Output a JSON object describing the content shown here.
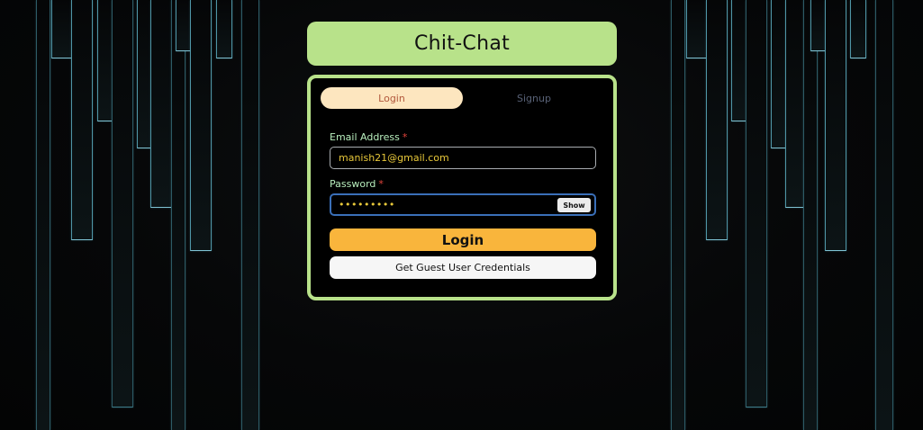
{
  "app": {
    "title": "Chit-Chat"
  },
  "tabs": [
    {
      "label": "Login",
      "active": true
    },
    {
      "label": "Signup",
      "active": false
    }
  ],
  "form": {
    "email": {
      "label": "Email Address",
      "required_mark": "*",
      "value": "manish21@gmail.com"
    },
    "password": {
      "label": "Password",
      "required_mark": "*",
      "masked_value": "•••••••••",
      "toggle_label": "Show"
    },
    "login_button": "Login",
    "guest_button": "Get Guest User Credentials"
  },
  "colors": {
    "accent_green": "#b8e28a",
    "login_button": "#f9b53c",
    "active_tab": "#fde6bf",
    "input_text": "#e8c83a",
    "label_text": "#b8eebd",
    "required": "#e5443c",
    "background": "#050607"
  }
}
